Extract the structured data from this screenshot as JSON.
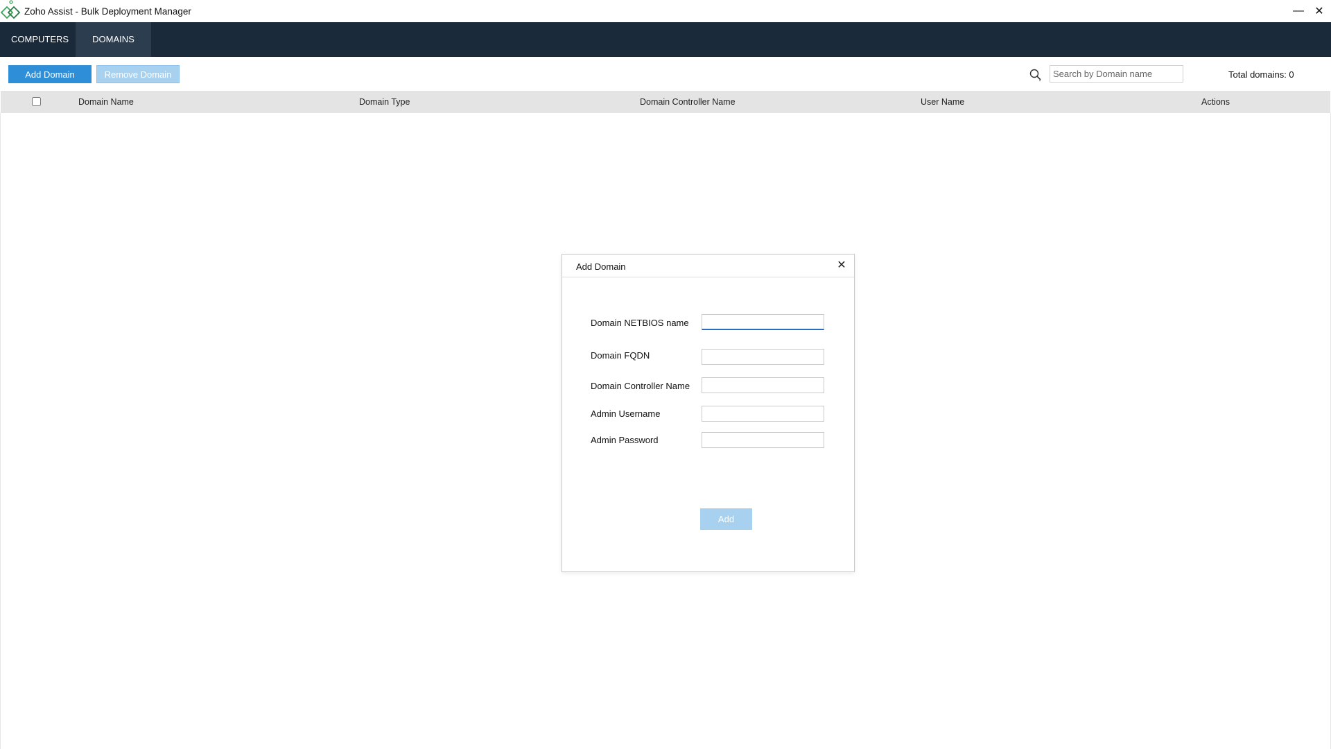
{
  "window": {
    "title": "Zoho Assist - Bulk Deployment Manager",
    "minimize_glyph": "—",
    "close_glyph": "✕"
  },
  "nav": {
    "tabs": [
      {
        "label": "COMPUTERS",
        "active": false
      },
      {
        "label": "DOMAINS",
        "active": true
      }
    ]
  },
  "toolbar": {
    "add_label": "Add Domain",
    "remove_label": "Remove Domain",
    "search_placeholder": "Search by Domain name",
    "total_label": "Total domains: 0"
  },
  "table": {
    "columns": [
      "Domain Name",
      "Domain Type",
      "Domain Controller Name",
      "User Name",
      "Actions"
    ],
    "rows": []
  },
  "dialog": {
    "title": "Add Domain",
    "close_glyph": "✕",
    "fields": [
      {
        "label": "Domain NETBIOS name",
        "value": ""
      },
      {
        "label": "Domain FQDN",
        "value": ""
      },
      {
        "label": "Domain Controller Name",
        "value": ""
      },
      {
        "label": "Admin Username",
        "value": ""
      },
      {
        "label": "Admin Password",
        "value": ""
      }
    ],
    "submit_label": "Add"
  },
  "colors": {
    "navbar": "#1b2a3a",
    "active_tab": "#2c3d4f",
    "primary_button": "#2f8ed8",
    "disabled_button": "#a8d1f0",
    "logo_green": "#3aa655"
  }
}
